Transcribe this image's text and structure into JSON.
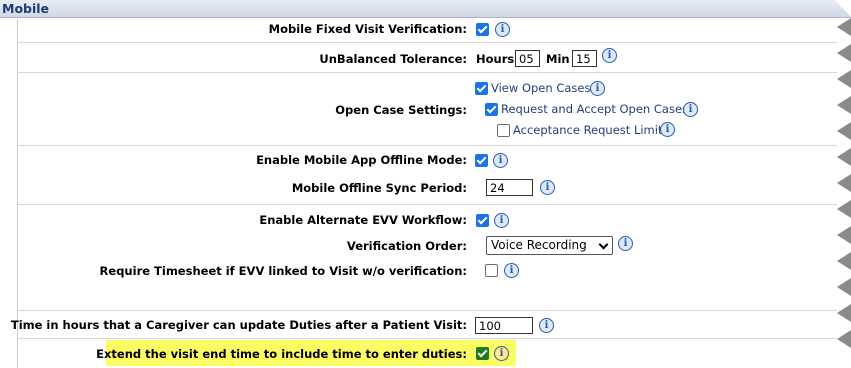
{
  "section_title": "Mobile",
  "rows": {
    "fixed_visit": {
      "label": "Mobile Fixed Visit Verification:",
      "checked": true
    },
    "unbalanced": {
      "label": "UnBalanced Tolerance:",
      "hours_label": "Hours",
      "hours_value": "05",
      "min_label": "Min",
      "min_value": "15"
    },
    "open_case": {
      "label": "Open Case Settings:",
      "options": [
        {
          "label": "View Open Cases",
          "checked": true
        },
        {
          "label": "Request and Accept Open Cases",
          "checked": true
        },
        {
          "label": "Acceptance Request Limit",
          "checked": false
        }
      ]
    },
    "offline_mode": {
      "label": "Enable Mobile App Offline Mode:",
      "checked": true
    },
    "sync_period": {
      "label": "Mobile Offline Sync Period:",
      "value": "24"
    },
    "alt_evv": {
      "label": "Enable Alternate EVV Workflow:",
      "checked": true
    },
    "verification_order": {
      "label": "Verification Order:",
      "selected": "Voice Recording"
    },
    "require_timesheet": {
      "label": "Require Timesheet if EVV linked to Visit w/o verification:",
      "checked": false
    },
    "duties_hours": {
      "label": "Time in hours that a Caregiver can update Duties after a Patient Visit:",
      "value": "100"
    },
    "extend_end": {
      "label": "Extend the visit end time to include time to enter duties:",
      "checked": true
    }
  },
  "info_icon": "info-icon",
  "colors": {
    "highlight": "#fbfb64",
    "checkbox": "#1a73e8",
    "link_text": "#23407a",
    "header_text": "#1f3b72"
  }
}
